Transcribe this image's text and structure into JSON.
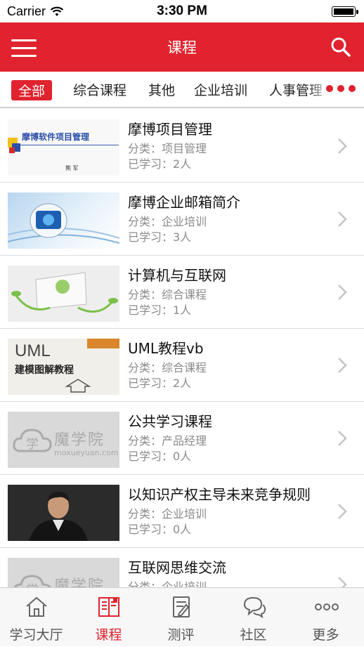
{
  "status_bar": {
    "carrier": "Carrier",
    "time": "3:30 PM"
  },
  "nav": {
    "title": "课程",
    "menu_icon": "menu-icon",
    "search_icon": "search-icon"
  },
  "categories": {
    "items": [
      "全部",
      "综合课程",
      "其他",
      "企业培训",
      "人事管理"
    ],
    "active": "全部",
    "more_icon": "more-dots-icon"
  },
  "courses": [
    {
      "title": "摩博项目管理",
      "category": "分类：项目管理",
      "studied": "已学习：2人",
      "thumb_text": "摩博软件项目管理",
      "thumb_sub": "熊 军"
    },
    {
      "title": "摩博企业邮箱简介",
      "category": "分类：企业培训",
      "studied": "已学习：3人"
    },
    {
      "title": "计算机与互联网",
      "category": "分类：综合课程",
      "studied": "已学习：1人"
    },
    {
      "title": "UML教程vb",
      "category": "分类：综合课程",
      "studied": "已学习：2人",
      "thumb_text": "UML",
      "thumb_sub": "建模图解教程"
    },
    {
      "title": "公共学习课程",
      "category": "分类：产品经理",
      "studied": "已学习：0人",
      "thumb_text": "魔学院",
      "thumb_sub": "moxueyuan.com"
    },
    {
      "title": "以知识产权主导未来竞争规则",
      "category": "分类：企业培训",
      "studied": "已学习：0人"
    },
    {
      "title": "互联网思维交流",
      "category": "分类：企业培训",
      "studied": "",
      "thumb_text": "魔学院"
    }
  ],
  "tabs": [
    {
      "label": "学习大厅",
      "icon": "home-icon"
    },
    {
      "label": "课程",
      "icon": "book-icon",
      "active": true
    },
    {
      "label": "测评",
      "icon": "edit-document-icon"
    },
    {
      "label": "社区",
      "icon": "chat-bubbles-icon"
    },
    {
      "label": "更多",
      "icon": "more-icon"
    }
  ],
  "colors": {
    "brand_red": "#e0232e",
    "text_gray": "#8a8a8a"
  }
}
